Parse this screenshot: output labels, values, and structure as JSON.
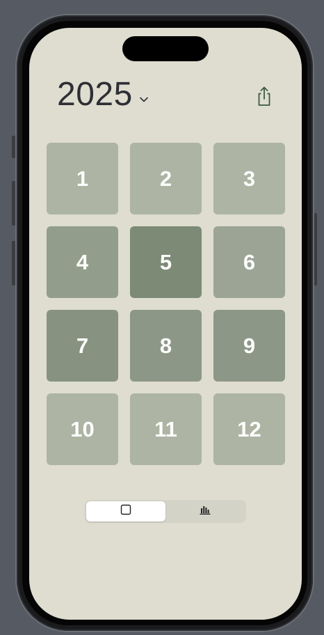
{
  "header": {
    "year": "2025",
    "year_menu_icon": "chevron-down-icon",
    "share_icon": "share-icon"
  },
  "months": [
    {
      "label": "1",
      "color": "#adb4a4"
    },
    {
      "label": "2",
      "color": "#adb4a4"
    },
    {
      "label": "3",
      "color": "#adb4a4"
    },
    {
      "label": "4",
      "color": "#929d8b"
    },
    {
      "label": "5",
      "color": "#7c8a76"
    },
    {
      "label": "6",
      "color": "#9ba495"
    },
    {
      "label": "7",
      "color": "#879280"
    },
    {
      "label": "8",
      "color": "#8d9787"
    },
    {
      "label": "9",
      "color": "#8d9787"
    },
    {
      "label": "10",
      "color": "#adb4a4"
    },
    {
      "label": "11",
      "color": "#adb4a4"
    },
    {
      "label": "12",
      "color": "#adb4a4"
    }
  ],
  "segmented": {
    "options": [
      {
        "icon": "square-icon",
        "selected": true
      },
      {
        "icon": "bar-chart-icon",
        "selected": false
      }
    ]
  },
  "colors": {
    "screen_bg": "#deddcf",
    "year_text": "#2e2f35",
    "icon_green": "#3c5a40"
  }
}
